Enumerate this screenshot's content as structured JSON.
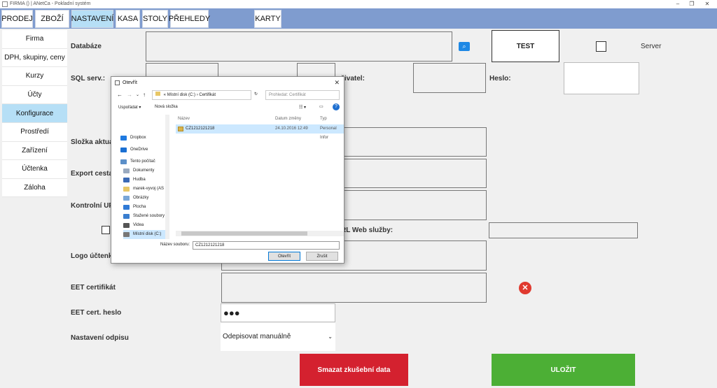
{
  "window": {
    "title": "FIRMA () | ANetCa - Pokladní systém",
    "controls": [
      "–",
      "❐",
      "✕"
    ]
  },
  "topnav": [
    "PRODEJ",
    "ZBOŽÍ",
    "NASTAVENÍ",
    "KASA",
    "STOLY",
    "PŘEHLEDY",
    "KARTY"
  ],
  "sidebar": [
    "Firma",
    "DPH, skupiny, ceny",
    "Kurzy",
    "Účty",
    "Konfigurace",
    "Prostředí",
    "Zařízení",
    "Účtenka",
    "Záloha"
  ],
  "form": {
    "databaze": "Databáze",
    "test": "TEST",
    "server": "Server",
    "sqlserv": "SQL serv.:",
    "uzivatel": "živatel:",
    "heslo": "Heslo:",
    "slozka": "Složka aktual",
    "export": "Export cesta:",
    "kontrolni": "Kontrolní URI",
    "url_web": "RL Web služby:",
    "logo": "Logo účtenky",
    "eet_cert": "EET certifikát",
    "eet_heslo": "EET cert. heslo",
    "eet_heslo_value": "●●●",
    "odpis": "Nastavení odpisu",
    "odpis_value": "Odepisovat manuálně",
    "smazat": "Smazat zkušební data",
    "ulozit": "ULOŽIT"
  },
  "dialog": {
    "title": "Otevřít",
    "address": [
      "«",
      "Místní disk (C:)",
      "›",
      "Certifikát"
    ],
    "search_placeholder": "Prohledat: Certifikát",
    "organize": "Uspořádat ▾",
    "new_folder": "Nová složka",
    "columns": {
      "name": "Název",
      "date": "Datum změny",
      "type": "Typ"
    },
    "tree": [
      "Dropbox",
      "OneDrive",
      "Tento počítač",
      "Dokumenty",
      "Hudba",
      "marek-vyvoj (AS",
      "Obrázky",
      "Plocha",
      "Stažené soubory",
      "Videa",
      "Místní disk (C:)"
    ],
    "file": {
      "name": "CZ1212121218",
      "date": "24.10.2016 12:49",
      "type": "Personal Infor"
    },
    "filename_label": "Název souboru:",
    "filename_value": "CZ1212121218",
    "open": "Otevřít",
    "cancel": "Zrušit"
  },
  "colors": {
    "nav_bg": "#7f9ccf",
    "active": "#b6dff6",
    "red": "#d4212f",
    "green": "#4caf35"
  }
}
